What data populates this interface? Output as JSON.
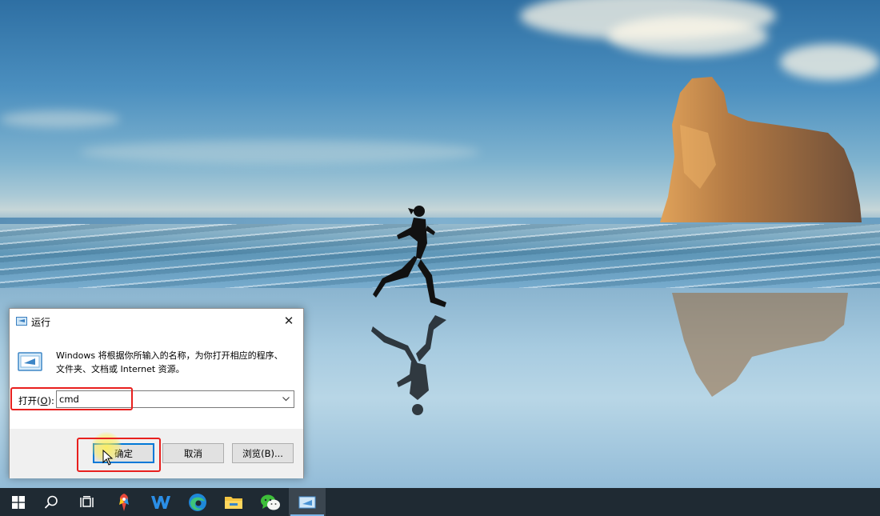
{
  "run_dialog": {
    "title": "运行",
    "description_line1": "Windows 将根据你所输入的名称，为你打开相应的程序、",
    "description_line2": "文件夹、文档或 Internet 资源。",
    "open_label_prefix": "打开(",
    "open_label_key": "O",
    "open_label_suffix": "):",
    "command_value": "cmd",
    "buttons": {
      "ok": "确定",
      "cancel": "取消",
      "browse": "浏览(B)..."
    }
  },
  "taskbar": {
    "items": [
      {
        "name": "start",
        "icon": "windows-logo-icon"
      },
      {
        "name": "search",
        "icon": "search-icon"
      },
      {
        "name": "task-view",
        "icon": "task-view-icon"
      },
      {
        "name": "app-pinned-1",
        "icon": "colorful-app-icon"
      },
      {
        "name": "wps-writer",
        "icon": "w-letter-icon"
      },
      {
        "name": "edge",
        "icon": "edge-browser-icon"
      },
      {
        "name": "file-explorer",
        "icon": "folder-icon"
      },
      {
        "name": "wechat",
        "icon": "wechat-icon"
      },
      {
        "name": "run",
        "icon": "run-dialog-icon",
        "active": true
      }
    ]
  },
  "colors": {
    "highlight_box": "#e8201e",
    "taskbar": "#1f2a33",
    "focus_blue": "#0078d7"
  }
}
